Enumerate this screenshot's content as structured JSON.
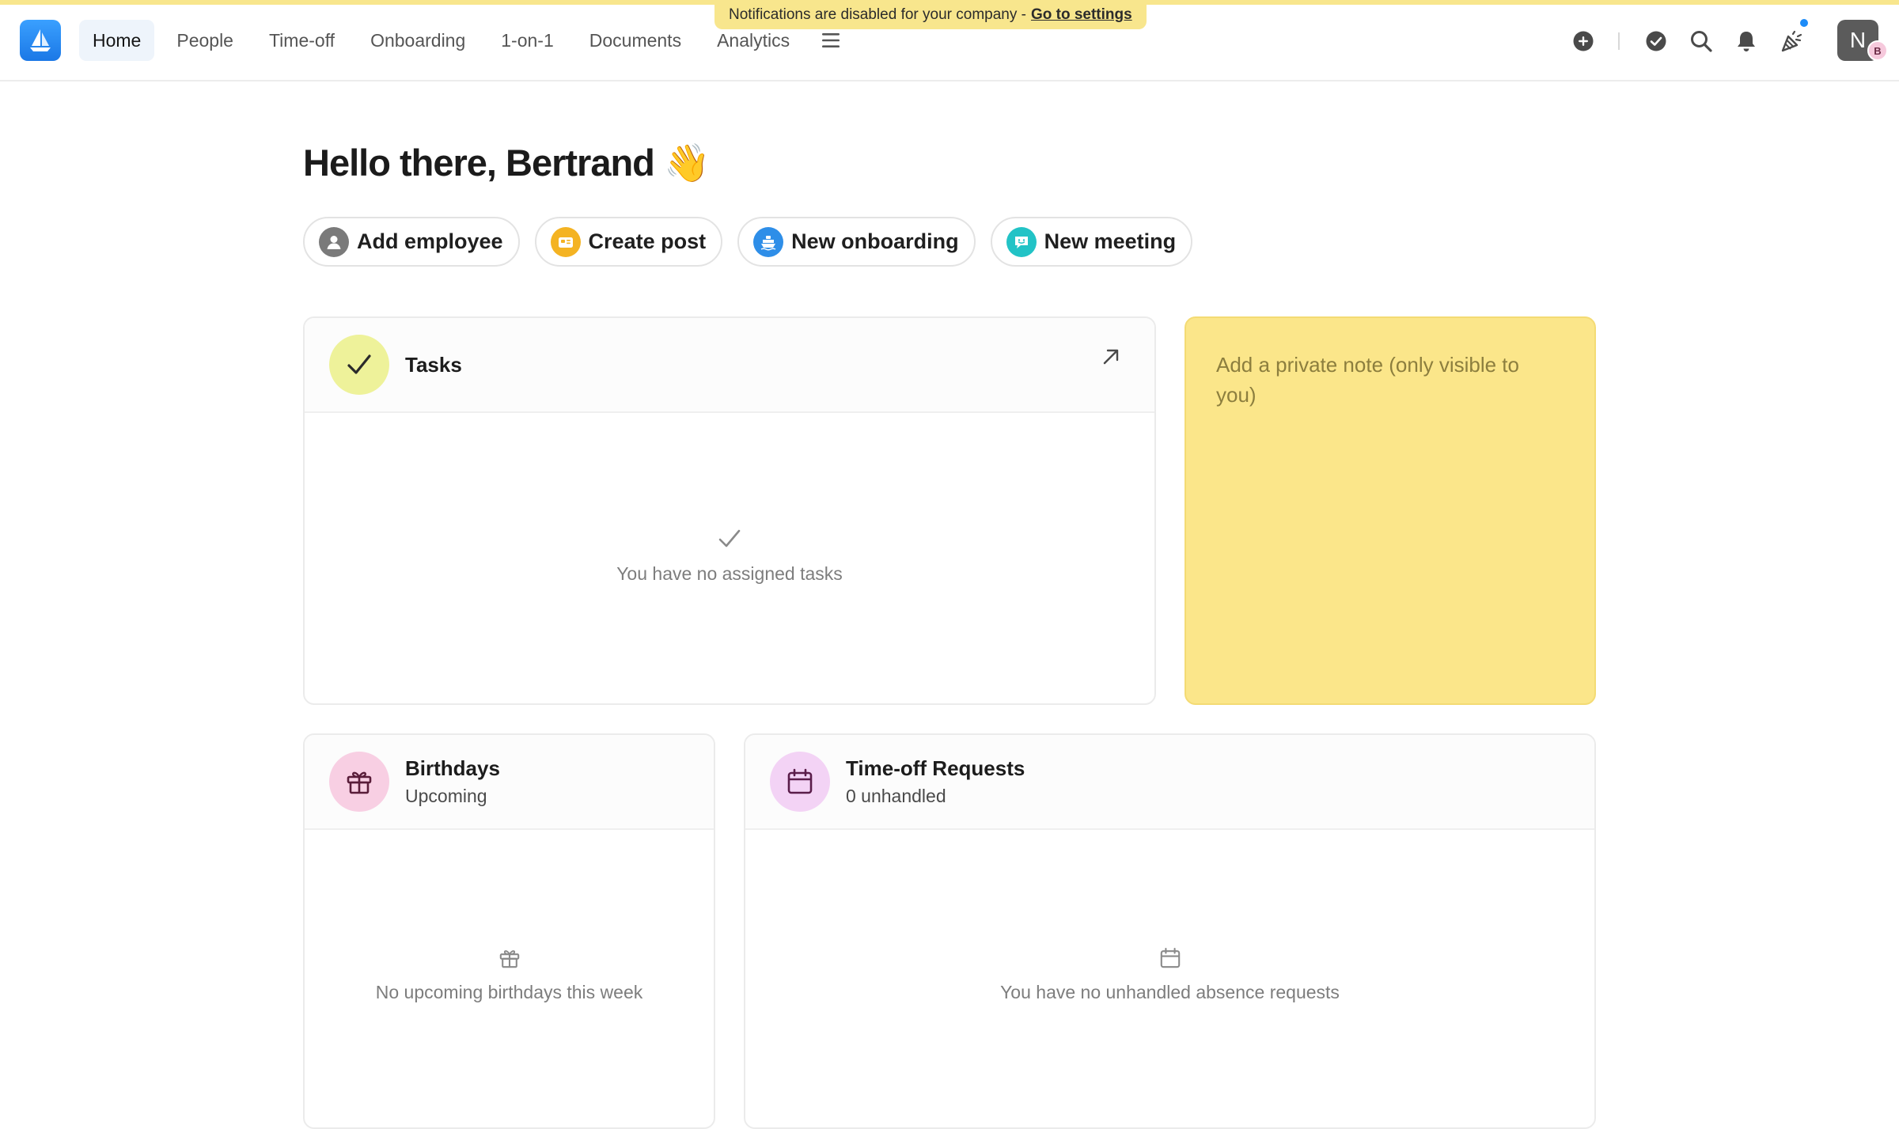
{
  "banner": {
    "text": "Notifications are disabled for your company -",
    "link": "Go to settings"
  },
  "nav": {
    "items": [
      {
        "label": "Home",
        "active": true
      },
      {
        "label": "People",
        "active": false
      },
      {
        "label": "Time-off",
        "active": false
      },
      {
        "label": "Onboarding",
        "active": false
      },
      {
        "label": "1-on-1",
        "active": false
      },
      {
        "label": "Documents",
        "active": false
      },
      {
        "label": "Analytics",
        "active": false
      }
    ],
    "right_icons": [
      "add-circle-icon",
      "check-circle-icon",
      "search-icon",
      "bell-icon",
      "party-popper-icon"
    ],
    "avatar_letter": "N",
    "avatar_badge": "B"
  },
  "greeting": "Hello there, Bertrand 👋",
  "actions": [
    {
      "label": "Add employee",
      "icon": "person-icon",
      "color": "#7a7a7a"
    },
    {
      "label": "Create post",
      "icon": "post-icon",
      "color": "#f4b322"
    },
    {
      "label": "New onboarding",
      "icon": "boat-icon",
      "color": "#2e8ee8"
    },
    {
      "label": "New meeting",
      "icon": "chat-smile-icon",
      "color": "#22c3c6"
    }
  ],
  "tasks": {
    "title": "Tasks",
    "empty_text": "You have no assigned tasks"
  },
  "note": {
    "placeholder": "Add a private note (only visible to you)"
  },
  "birthdays": {
    "title": "Birthdays",
    "subtitle": "Upcoming",
    "empty_text": "No upcoming birthdays this week"
  },
  "timeoff": {
    "title": "Time-off Requests",
    "subtitle": "0 unhandled",
    "empty_text": "You have no unhandled absence requests"
  },
  "colors": {
    "banner": "#f8e68d",
    "note": "#fbe68a",
    "tasks_icon_bg": "#eef29a",
    "birthday_icon_bg": "#f8cfe3",
    "timeoff_icon_bg": "#f3d3f5",
    "brand": "#1d8cf8"
  }
}
